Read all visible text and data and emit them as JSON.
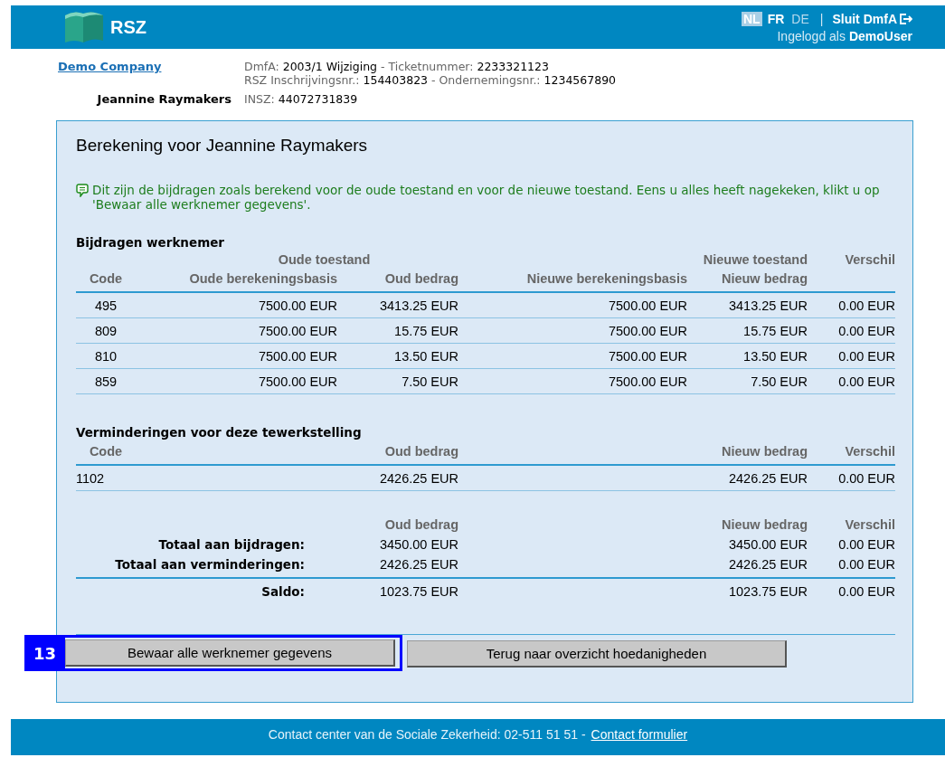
{
  "header": {
    "logo_text": "RSZ",
    "languages": [
      {
        "label": "NL",
        "selected": true,
        "disabled": false
      },
      {
        "label": "FR",
        "selected": false,
        "disabled": false
      },
      {
        "label": "DE",
        "selected": false,
        "disabled": true
      }
    ],
    "separator": "|",
    "logout": "Sluit DmfA",
    "login_prefix": "Ingelogd als",
    "user": "DemoUser"
  },
  "info": {
    "company": "Demo Company",
    "employee": "Jeannine Raymakers",
    "lines": [
      [
        {
          "kind": "label",
          "text": "DmfA:"
        },
        {
          "kind": "value",
          "text": "2003/1 Wijziging"
        },
        {
          "kind": "label",
          "text": "- Ticketnummer:"
        },
        {
          "kind": "value",
          "text": "2233321123"
        }
      ],
      [
        {
          "kind": "label",
          "text": "RSZ Inschrijvingsnr.:"
        },
        {
          "kind": "value",
          "text": "154403823"
        },
        {
          "kind": "label",
          "text": "- Ondernemingsnr.:"
        },
        {
          "kind": "value",
          "text": "1234567890"
        }
      ]
    ],
    "insz": [
      {
        "kind": "label",
        "text": "INSZ:"
      },
      {
        "kind": "value",
        "text": "44072731839"
      }
    ]
  },
  "panel": {
    "title": "Berekening voor Jeannine Raymakers",
    "note": "Dit zijn de bijdragen zoals berekend voor de oude toestand en voor de nieuwe toestand. Eens u alles heeft nagekeken, klikt u op 'Bewaar alle werknemer gegevens'.",
    "contributions": {
      "title": "Bijdragen werknemer",
      "group_headers": [
        "Oude toestand",
        "Nieuwe toestand",
        "Verschil"
      ],
      "columns": [
        "Code",
        "Oude berekeningsbasis",
        "Oud bedrag",
        "Nieuwe berekeningsbasis",
        "Nieuw bedrag"
      ],
      "rows": [
        [
          "495",
          "7500.00 EUR",
          "3413.25 EUR",
          "7500.00 EUR",
          "3413.25 EUR",
          "0.00 EUR"
        ],
        [
          "809",
          "7500.00 EUR",
          "15.75 EUR",
          "7500.00 EUR",
          "15.75 EUR",
          "0.00 EUR"
        ],
        [
          "810",
          "7500.00 EUR",
          "13.50 EUR",
          "7500.00 EUR",
          "13.50 EUR",
          "0.00 EUR"
        ],
        [
          "859",
          "7500.00 EUR",
          "7.50 EUR",
          "7500.00 EUR",
          "7.50 EUR",
          "0.00 EUR"
        ]
      ]
    },
    "reductions": {
      "title": "Verminderingen voor deze tewerkstelling",
      "columns": [
        "Code",
        "Oud bedrag",
        "Nieuw bedrag",
        "Verschil"
      ],
      "rows": [
        [
          "1102",
          "2426.25 EUR",
          "2426.25 EUR",
          "0.00 EUR"
        ]
      ]
    },
    "totals": {
      "columns": [
        "Oud bedrag",
        "Nieuw bedrag",
        "Verschil"
      ],
      "rows": [
        {
          "label": "Totaal aan bijdragen:",
          "values": [
            "3450.00 EUR",
            "3450.00 EUR",
            "0.00 EUR"
          ]
        },
        {
          "label": "Totaal aan verminderingen:",
          "values": [
            "2426.25 EUR",
            "2426.25 EUR",
            "0.00 EUR"
          ]
        }
      ],
      "balance": {
        "label": "Saldo:",
        "values": [
          "1023.75 EUR",
          "1023.75 EUR",
          "0.00 EUR"
        ]
      }
    },
    "buttons": [
      {
        "label": "Bewaar alle werknemer gegevens",
        "highlighted": true
      },
      {
        "label": "Terug naar overzicht hoedanigheden",
        "highlighted": false
      }
    ],
    "annotation": {
      "label": "13"
    }
  },
  "footer": {
    "text": "Contact center van de Sociale Zekerheid: 02-511 51 51 -",
    "link": "Contact formulier"
  }
}
